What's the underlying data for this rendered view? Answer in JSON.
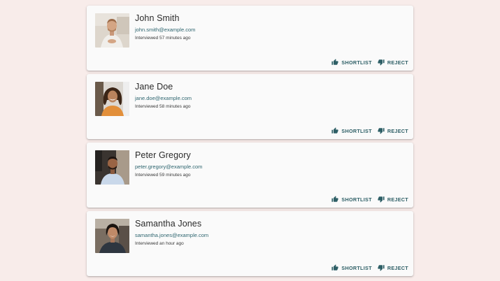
{
  "candidates": [
    {
      "name": "John Smith",
      "email": "john.smith@example.com",
      "status": "Interviewed 57 minutes ago",
      "shortlist_label": "SHORTLIST",
      "reject_label": "REJECT"
    },
    {
      "name": "Jane Doe",
      "email": "jane.doe@example.com",
      "status": "Interviewed 58 minutes ago",
      "shortlist_label": "SHORTLIST",
      "reject_label": "REJECT"
    },
    {
      "name": "Peter Gregory",
      "email": "peter.gregory@example.com",
      "status": "Interviewed 59 minutes ago",
      "shortlist_label": "SHORTLIST",
      "reject_label": "REJECT"
    },
    {
      "name": "Samantha Jones",
      "email": "samantha.jones@example.com",
      "status": "Interviewed an hour ago",
      "shortlist_label": "SHORTLIST",
      "reject_label": "REJECT"
    }
  ],
  "icons": {
    "shortlist": "thumb-up-icon",
    "reject": "thumb-down-icon"
  },
  "colors": {
    "background": "#f8ecea",
    "card": "#fafafa",
    "accent": "#2e5f66",
    "email": "#2f6670"
  }
}
